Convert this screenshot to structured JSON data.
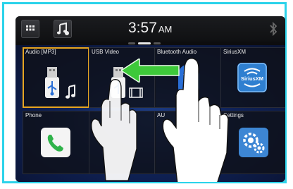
{
  "status_bar": {
    "time": "3:57",
    "ampm": "AM"
  },
  "tiles": [
    {
      "label": "Audio [MP3]"
    },
    {
      "label": "USB Video"
    },
    {
      "label": "Bluetooth Audio"
    },
    {
      "label": "SiriusXM",
      "logo_text": "SiriusXM"
    },
    {
      "label": "Phone"
    },
    {
      "label": ""
    },
    {
      "label": "AU"
    },
    {
      "label": "Settings"
    }
  ],
  "colors": {
    "frame": "#2bd3ea",
    "selection": "#e7a520",
    "swipe_arrow": "#3ec93a"
  },
  "icons": [
    "menu-grid-icon",
    "music-note-icon",
    "bluetooth-icon",
    "usb-icon",
    "phone-icon",
    "gear-icon"
  ]
}
